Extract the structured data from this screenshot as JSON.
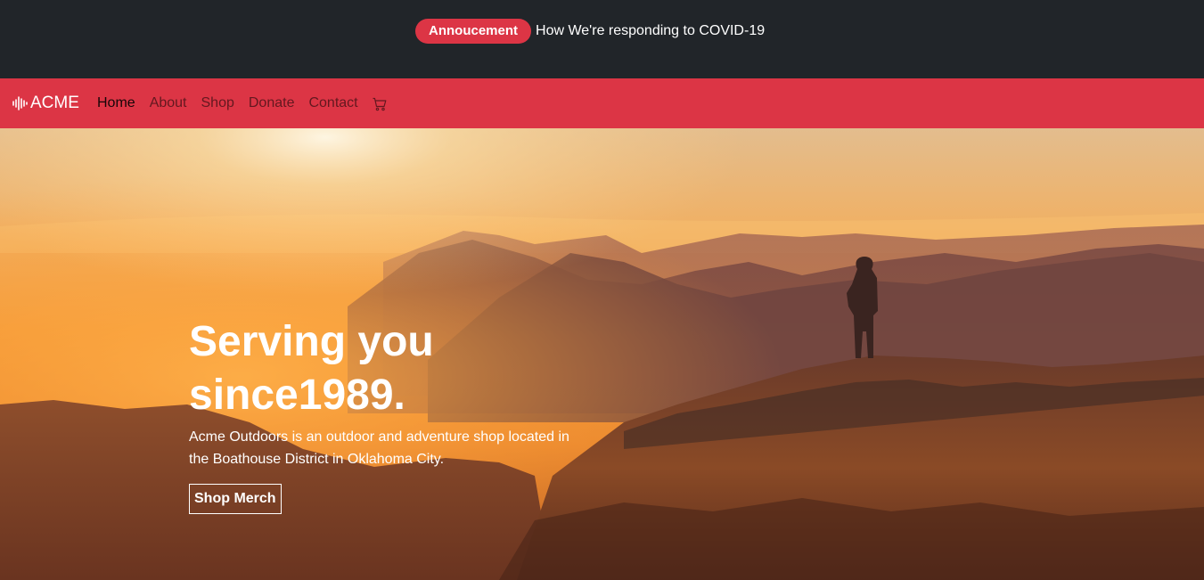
{
  "announcement": {
    "badge": "Annoucement",
    "text": "How We're responding to COVID-19"
  },
  "navbar": {
    "brand": "ACME",
    "brand_icon": "soundwave-icon",
    "links": [
      {
        "label": "Home",
        "active": true
      },
      {
        "label": "About",
        "active": false
      },
      {
        "label": "Shop",
        "active": false
      },
      {
        "label": "Donate",
        "active": false
      },
      {
        "label": "Contact",
        "active": false
      }
    ],
    "cart_icon": "cart-icon"
  },
  "hero": {
    "title": "Serving you since1989.",
    "description": "Acme Outdoors is an outdoor and adventure shop located in the Boathouse District in Oklahoma City.",
    "button": "Shop Merch"
  },
  "colors": {
    "dark": "#212529",
    "accent": "#dc3545",
    "text_light": "#ffffff"
  }
}
